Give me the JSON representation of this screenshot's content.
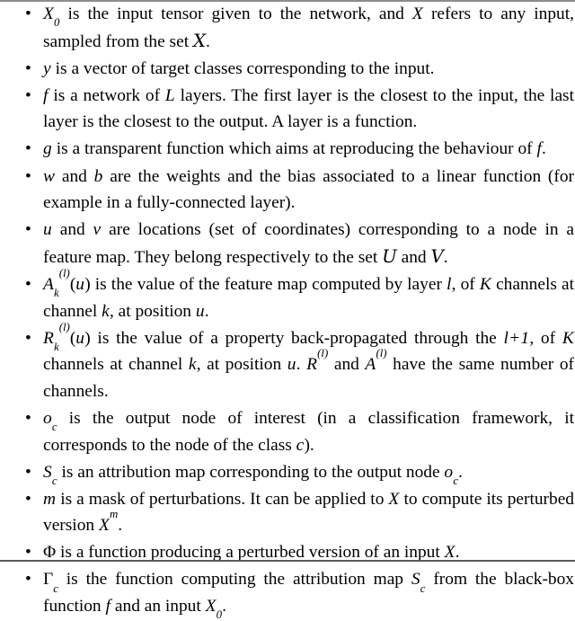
{
  "document": {
    "kind": "latex-notation-list",
    "top_rule_color": "#8d8d8d",
    "bottom_rule_color": "#5a5a5a",
    "background_color": "#ffffff",
    "text_color": "#000000",
    "bullet_glyph": "•"
  },
  "items": [
    {
      "id": "X0",
      "symbol": "X₀",
      "text": "X₀ is the input tensor given to the network, and X refers to any input, sampled from the set 𝒳.",
      "parts": [
        {
          "t": "math",
          "v": "X",
          "sub": "0"
        },
        {
          "t": "text",
          "v": " is the input tensor given to the network, and "
        },
        {
          "t": "math",
          "v": "X"
        },
        {
          "t": "text",
          "v": " refers to any input, sampled from the set "
        },
        {
          "t": "cal",
          "v": "X"
        },
        {
          "t": "text",
          "v": "."
        }
      ]
    },
    {
      "id": "y",
      "symbol": "y",
      "text": "y is a vector of target classes corresponding to the input.",
      "parts": [
        {
          "t": "math",
          "v": "y"
        },
        {
          "t": "text",
          "v": " is a vector of target classes corresponding to the input."
        }
      ]
    },
    {
      "id": "f",
      "symbol": "f",
      "text": "f is a network of L layers. The first layer is the closest to the input, the last layer is the closest to the output. A layer is a function.",
      "parts": [
        {
          "t": "math",
          "v": "f"
        },
        {
          "t": "text",
          "v": " is a network of "
        },
        {
          "t": "math",
          "v": "L"
        },
        {
          "t": "text",
          "v": " layers.  The first layer is the closest to the input, the last layer is the closest to the output. A layer is a function."
        }
      ]
    },
    {
      "id": "g",
      "symbol": "g",
      "text": "g is a transparent function which aims at reproducing the behaviour of f.",
      "parts": [
        {
          "t": "math",
          "v": "g"
        },
        {
          "t": "text",
          "v": " is a transparent function which aims at reproducing the behaviour of "
        },
        {
          "t": "math",
          "v": "f"
        },
        {
          "t": "text",
          "v": "."
        }
      ]
    },
    {
      "id": "w-b",
      "symbol": "w, b",
      "text": "w and b are the weights and the bias associated to a linear function (for example in a fully-connected layer).",
      "parts": [
        {
          "t": "math",
          "v": "w"
        },
        {
          "t": "text",
          "v": " and "
        },
        {
          "t": "math",
          "v": "b"
        },
        {
          "t": "text",
          "v": " are the weights and the bias associated to a linear function (for example in a fully-connected layer)."
        }
      ]
    },
    {
      "id": "u-v",
      "symbol": "u, v",
      "text": "u and v are locations (set of coordinates) corresponding to a node in a feature map. They belong respectively to the set 𝒰 and 𝒱.",
      "parts": [
        {
          "t": "math",
          "v": "u"
        },
        {
          "t": "text",
          "v": " and "
        },
        {
          "t": "math",
          "v": "v"
        },
        {
          "t": "text",
          "v": " are locations (set of coordinates) corresponding to a node in a feature map.  They belong respectively to the set "
        },
        {
          "t": "cal",
          "v": "U"
        },
        {
          "t": "text",
          "v": " and "
        },
        {
          "t": "cal",
          "v": "V"
        },
        {
          "t": "text",
          "v": "."
        }
      ]
    },
    {
      "id": "A_k_l",
      "symbol": "A_k^(l)(u)",
      "text": "A_k^(l)(u) is the value of the feature map computed by layer l, of K channels at channel k, at position u.",
      "parts": [
        {
          "t": "math",
          "v": "A",
          "sub": "k",
          "sup": "(l)"
        },
        {
          "t": "math-paren",
          "v": "u"
        },
        {
          "t": "text",
          "v": " is the value of the feature map computed by layer "
        },
        {
          "t": "math",
          "v": "l"
        },
        {
          "t": "text",
          "v": ", of "
        },
        {
          "t": "math",
          "v": "K"
        },
        {
          "t": "text",
          "v": " channels at channel "
        },
        {
          "t": "math",
          "v": "k"
        },
        {
          "t": "text",
          "v": ", at position "
        },
        {
          "t": "math",
          "v": "u"
        },
        {
          "t": "text",
          "v": "."
        }
      ]
    },
    {
      "id": "R_k_l",
      "symbol": "R_k^(l)(u)",
      "text": "R_k^(l)(u) is the value of a property back-propagated through the l+1, of K channels at channel k, at position u. R^(l) and A^(l) have the same number of channels.",
      "parts": [
        {
          "t": "math",
          "v": "R",
          "sub": "k",
          "sup": "(l)"
        },
        {
          "t": "math-paren",
          "v": "u"
        },
        {
          "t": "text",
          "v": " is the value of a property back-propagated through the "
        },
        {
          "t": "math",
          "v": "l+1"
        },
        {
          "t": "text",
          "v": ", of "
        },
        {
          "t": "math",
          "v": "K"
        },
        {
          "t": "text",
          "v": " channels at channel "
        },
        {
          "t": "math",
          "v": "k"
        },
        {
          "t": "text",
          "v": ", at position "
        },
        {
          "t": "math",
          "v": "u"
        },
        {
          "t": "text",
          "v": ".  "
        },
        {
          "t": "math",
          "v": "R",
          "sup": "(l)"
        },
        {
          "t": "text",
          "v": " and "
        },
        {
          "t": "math",
          "v": "A",
          "sup": "(l)"
        },
        {
          "t": "text",
          "v": " have the same number of channels."
        }
      ]
    },
    {
      "id": "o_c",
      "symbol": "o_c",
      "text": "o_c is the output node of interest (in a classification framework, it corresponds to the node of the class c).",
      "parts": [
        {
          "t": "math",
          "v": "o",
          "sub": "c"
        },
        {
          "t": "text",
          "v": " is the output node of interest (in a classification framework, it corresponds to the node of the class "
        },
        {
          "t": "math",
          "v": "c"
        },
        {
          "t": "text",
          "v": ")."
        }
      ]
    },
    {
      "id": "S_c",
      "symbol": "S_c",
      "text": "S_c is an attribution map corresponding to the output node o_c.",
      "parts": [
        {
          "t": "math",
          "v": "S",
          "sub": "c"
        },
        {
          "t": "text",
          "v": " is an attribution map corresponding to the output node "
        },
        {
          "t": "math",
          "v": "o",
          "sub": "c"
        },
        {
          "t": "text",
          "v": "."
        }
      ]
    },
    {
      "id": "m",
      "symbol": "m",
      "text": "m is a mask of perturbations. It can be applied to X to compute its perturbed version X^m.",
      "parts": [
        {
          "t": "math",
          "v": "m"
        },
        {
          "t": "text",
          "v": " is a mask of perturbations.  It can be applied to "
        },
        {
          "t": "math",
          "v": "X"
        },
        {
          "t": "text",
          "v": " to compute its perturbed version "
        },
        {
          "t": "math",
          "v": "X",
          "sup": "m"
        },
        {
          "t": "text",
          "v": "."
        }
      ]
    },
    {
      "id": "Phi",
      "symbol": "Φ",
      "text": "Φ is a function producing a perturbed version of an input X.",
      "parts": [
        {
          "t": "upgreek",
          "v": "Φ"
        },
        {
          "t": "text",
          "v": " is a function producing a perturbed version of an input "
        },
        {
          "t": "math",
          "v": "X"
        },
        {
          "t": "text",
          "v": "."
        }
      ]
    },
    {
      "id": "Gamma_c",
      "symbol": "Γ_c",
      "text": "Γ_c is the function computing the attribution map S_c from the black-box function f and an input X₀.",
      "parts": [
        {
          "t": "upgreek",
          "v": "Γ",
          "sub": "c"
        },
        {
          "t": "text",
          "v": " is the function computing the attribution map "
        },
        {
          "t": "math",
          "v": "S",
          "sub": "c"
        },
        {
          "t": "text",
          "v": " from the black-box function "
        },
        {
          "t": "math",
          "v": "f"
        },
        {
          "t": "text",
          "v": " and an input "
        },
        {
          "t": "math",
          "v": "X",
          "sub": "0"
        },
        {
          "t": "text",
          "v": "."
        }
      ]
    }
  ]
}
